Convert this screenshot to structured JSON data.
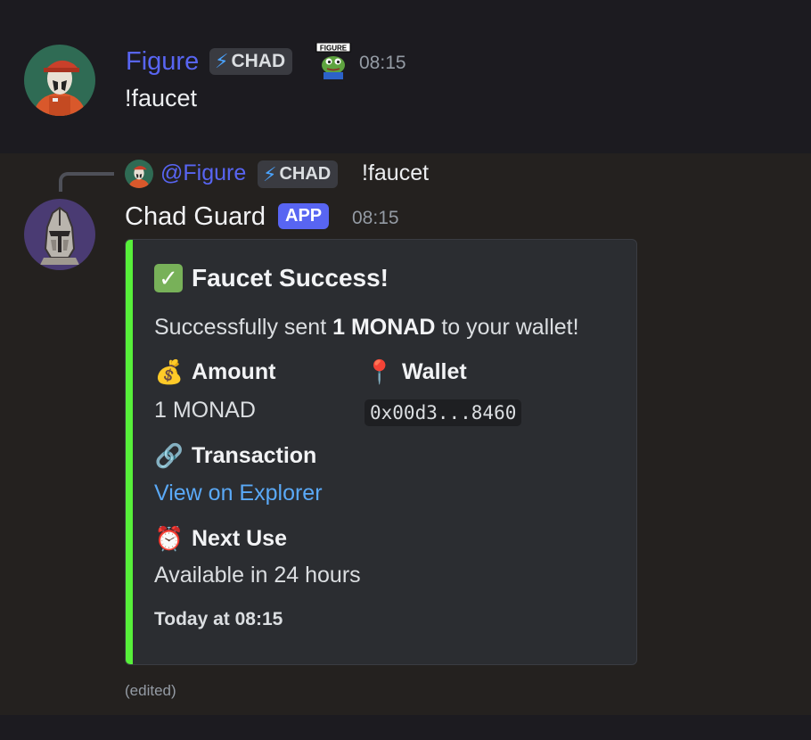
{
  "colors": {
    "embed_accent": "#57f03a",
    "app_badge": "#5865f2",
    "mention": "#5865f2",
    "link": "#5aa9f7"
  },
  "message1": {
    "username": "Figure",
    "role_tag": "CHAD",
    "role_tag_icon": "lightning-bolt-icon",
    "badge_emoji_label": "FIGURE",
    "timestamp": "08:15",
    "content": "!faucet"
  },
  "message2": {
    "reply": {
      "mention": "@Figure",
      "role_tag": "CHAD",
      "content": "!faucet"
    },
    "username": "Chad Guard",
    "app_badge": "APP",
    "timestamp": "08:15",
    "embed": {
      "title": "Faucet Success!",
      "title_icon": "check-mark-icon",
      "description_prefix": "Successfully sent ",
      "description_bold": "1 MONAD",
      "description_suffix": " to your wallet!",
      "fields": {
        "amount": {
          "icon": "money-bag-icon",
          "name": "Amount",
          "value": "1 MONAD"
        },
        "wallet": {
          "icon": "pushpin-icon",
          "name": "Wallet",
          "value": "0x00d3...8460"
        },
        "transaction": {
          "icon": "link-icon",
          "name": "Transaction",
          "value": "View on Explorer"
        },
        "next_use": {
          "icon": "alarm-clock-icon",
          "name": "Next Use",
          "value": "Available in 24 hours"
        }
      },
      "footer": "Today at 08:15"
    },
    "edited_label": "(edited)"
  }
}
